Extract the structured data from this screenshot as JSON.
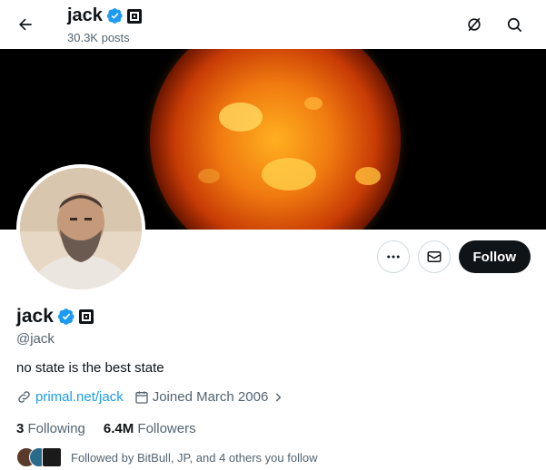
{
  "header": {
    "name": "jack",
    "posts": "30.3K posts",
    "icons": [
      "back-arrow-icon",
      "verified-badge-icon",
      "affiliate-badge-icon",
      "nostr-icon",
      "search-icon"
    ]
  },
  "profile": {
    "name": "jack",
    "handle": "@jack",
    "bio": "no state is the best state",
    "link": "primal.net/jack",
    "joined": "Joined March 2006",
    "following_count": "3",
    "following_label": "Following",
    "followers_count": "6.4M",
    "followers_label": "Followers",
    "followed_by": "Followed by BitBull, JP, and 4 others you follow"
  },
  "actions": {
    "follow_label": "Follow",
    "icons": [
      "more-icon",
      "message-icon"
    ]
  },
  "colors": {
    "link": "#1d9bf0",
    "verified": "#1d9bf0",
    "text": "#0f1419",
    "secondary": "#536471",
    "follow_bg": "#0f1419"
  }
}
